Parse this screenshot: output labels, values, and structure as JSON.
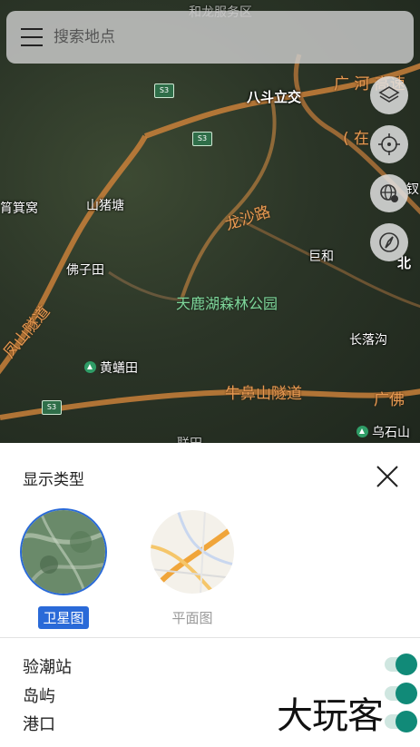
{
  "search": {
    "placeholder": "搜索地点",
    "menu_icon": "menu-icon"
  },
  "map": {
    "labels": {
      "top_blur": "和龙服务区",
      "bado": "八斗立交",
      "guanghe": "广 河 高速",
      "zai": "( 在",
      "jia": "钗",
      "qiji": "筲箕窝",
      "shanzhutang": "山猪塘",
      "longsha": "龙沙路",
      "juhe": "巨和",
      "bei": "北",
      "fozitian": "佛子田",
      "tianlu": "天鹿湖森林公园",
      "fengshan": "凤山隧道",
      "changluo": "长落沟",
      "huangqutian": "黄蟮田",
      "niubishan": "牛鼻山隧道",
      "guangfo": "广佛",
      "wushishan": "乌石山",
      "bottom_cut": "联田"
    },
    "shields": [
      "S3",
      "S3",
      "S3"
    ],
    "buttons": [
      "layers-icon",
      "locate-icon",
      "globe-icon",
      "compass-icon"
    ]
  },
  "panel": {
    "title": "显示类型",
    "types": [
      {
        "label": "卫星图",
        "selected": true
      },
      {
        "label": "平面图",
        "selected": false
      }
    ],
    "layers": [
      {
        "label": "验潮站",
        "on": true
      },
      {
        "label": "岛屿",
        "on": true
      },
      {
        "label": "港口",
        "on": true
      }
    ],
    "watermark": "大玩客"
  },
  "colors": {
    "accent": "#2a6ad8",
    "toggle": "#118a78",
    "road": "#c9803a"
  }
}
